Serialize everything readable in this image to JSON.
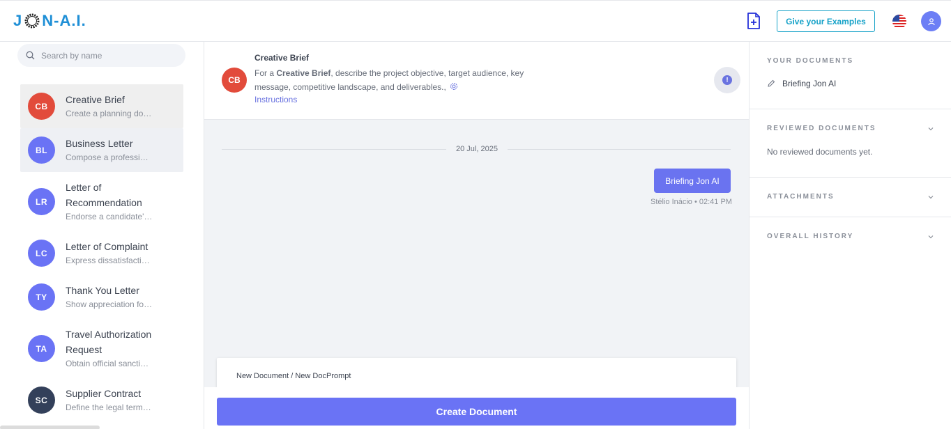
{
  "header": {
    "logo_prefix": "J",
    "logo_suffix": "N-A.I.",
    "examples_button": "Give your Examples",
    "icons": [
      "doc-plus-icon",
      "us-flag-icon",
      "user-icon"
    ]
  },
  "sidebar": {
    "search_placeholder": "Search by name",
    "items": [
      {
        "initials": "CB",
        "title": "Creative Brief",
        "subtitle": "Create a planning document for a creative project",
        "color": "#e24b3b"
      },
      {
        "initials": "BL",
        "title": "Business Letter",
        "subtitle": "Compose a professional business letter",
        "color": "#6a73f5"
      },
      {
        "initials": "LR",
        "title": "Letter of Recommendation",
        "subtitle": "Endorse a candidate's qualifications",
        "color": "#6a73f5"
      },
      {
        "initials": "LC",
        "title": "Letter of Complaint",
        "subtitle": "Express dissatisfaction with a service",
        "color": "#6a73f5"
      },
      {
        "initials": "TY",
        "title": "Thank You Letter",
        "subtitle": "Show appreciation for someone",
        "color": "#6a73f5"
      },
      {
        "initials": "TA",
        "title": "Travel Authorization Request",
        "subtitle": "Obtain official sanction for travel",
        "color": "#6a73f5"
      },
      {
        "initials": "SC",
        "title": "Supplier Contract",
        "subtitle": "Define the legal terms of supply",
        "color": "#33405a"
      }
    ]
  },
  "brief": {
    "initials": "CB",
    "title": "Creative Brief",
    "desc_pre": "For a ",
    "desc_bold": "Creative Brief",
    "desc_post": ", describe the project objective, target audience, key message, competitive landscape, and deliverables.,",
    "instructions": "Instructions"
  },
  "chat": {
    "date": "20 Jul, 2025",
    "message": "Briefing Jon AI",
    "meta": "Stélio Inácio • 02:41 PM",
    "prompt_path": "New Document / New DocPrompt",
    "create_button": "Create Document"
  },
  "right": {
    "your_documents": "YOUR DOCUMENTS",
    "document_item": "Briefing Jon AI",
    "reviewed_documents": "REVIEWED DOCUMENTS",
    "no_reviewed": "No reviewed documents yet.",
    "attachments": "ATTACHMENTS",
    "overall_history": "OVERALL HISTORY"
  }
}
